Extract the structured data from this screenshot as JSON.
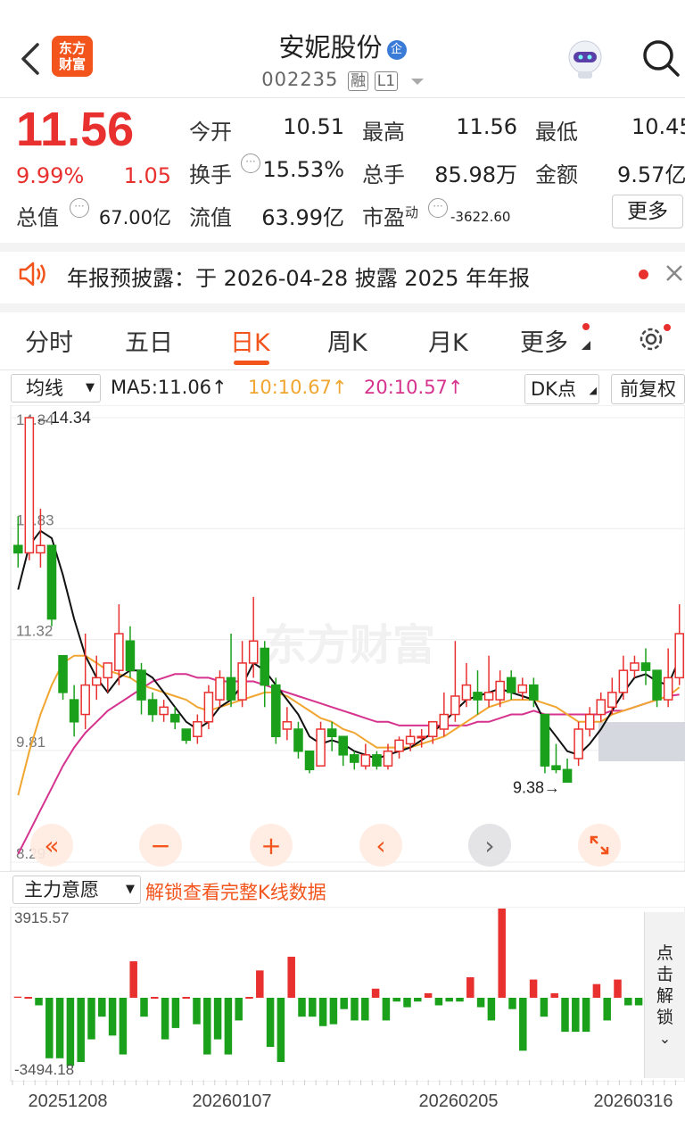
{
  "header": {
    "logo_line1": "东方",
    "logo_line2": "财富",
    "stock_name": "安妮股份",
    "badge": "企",
    "stock_code": "002235",
    "tag_rong": "融",
    "tag_level": "L1"
  },
  "quote": {
    "price": "11.56",
    "change_pct": "9.99%",
    "change_amt": "1.05",
    "fields": [
      {
        "label": "今开",
        "value": "10.51",
        "color": "#222222"
      },
      {
        "label": "最高",
        "value": "11.56",
        "color": "#e8312f"
      },
      {
        "label": "最低",
        "value": "10.45",
        "color": "#1aa01a"
      },
      {
        "label": "换手",
        "value": "15.53%",
        "color": "#222222"
      },
      {
        "label": "总手",
        "value": "85.98万",
        "color": "#222222"
      },
      {
        "label": "金额",
        "value": "9.57亿",
        "color": "#222222"
      },
      {
        "label": "总值",
        "value": "67.00亿",
        "color": "#222222"
      },
      {
        "label": "流值",
        "value": "63.99亿",
        "color": "#222222"
      },
      {
        "label": "市盈",
        "sup": "动",
        "value": "-3622.60",
        "color": "#222222"
      }
    ],
    "more_button": "更多"
  },
  "notice": {
    "text": "年报预披露：于 2026-04-28 披露 2025 年年报"
  },
  "tabs": [
    "分时",
    "五日",
    "日K",
    "周K",
    "月K",
    "更多"
  ],
  "active_tab": "日K",
  "indicator_bar": {
    "select": "均线",
    "ma5": "MA5:11.06",
    "ma10": "10:10.67",
    "ma20": "20:10.57",
    "dk_button": "DK点",
    "adjust_button": "前复权"
  },
  "chart_data": {
    "type": "candlestick",
    "y_ticks": [
      "14.34",
      "12.83",
      "11.32",
      "9.81",
      "8.29"
    ],
    "ylim": [
      8.29,
      14.34
    ],
    "max_label": "14.34",
    "min_label": "9.38",
    "watermark": "东方财富",
    "x_ticks": [
      "20251208",
      "20260107",
      "20260205",
      "20260316"
    ],
    "candles": [
      [
        12.6,
        12.5,
        13.0,
        12.3
      ],
      [
        12.5,
        14.34,
        14.34,
        12.4
      ],
      [
        12.5,
        12.6,
        13.1,
        12.3
      ],
      [
        12.6,
        11.6,
        12.6,
        11.5
      ],
      [
        11.1,
        10.6,
        11.1,
        10.5
      ],
      [
        10.5,
        10.2,
        10.7,
        10.0
      ],
      [
        10.3,
        10.7,
        11.4,
        10.1
      ],
      [
        10.7,
        10.8,
        11.1,
        10.5
      ],
      [
        10.8,
        11.0,
        11.0,
        10.6
      ],
      [
        10.9,
        11.4,
        11.8,
        10.7
      ],
      [
        11.3,
        10.9,
        11.5,
        10.8
      ],
      [
        10.9,
        10.5,
        11.0,
        10.3
      ],
      [
        10.5,
        10.3,
        10.6,
        10.2
      ],
      [
        10.3,
        10.4,
        10.5,
        10.2
      ],
      [
        10.3,
        10.2,
        10.4,
        10.1
      ],
      [
        10.1,
        9.95,
        10.1,
        9.9
      ],
      [
        10.0,
        10.2,
        10.3,
        9.9
      ],
      [
        10.2,
        10.6,
        10.7,
        10.1
      ],
      [
        10.5,
        10.8,
        10.9,
        10.4
      ],
      [
        10.8,
        10.5,
        11.4,
        10.4
      ],
      [
        10.5,
        11.0,
        11.3,
        10.4
      ],
      [
        11.0,
        11.3,
        11.9,
        10.8
      ],
      [
        11.2,
        10.7,
        11.3,
        10.4
      ],
      [
        10.7,
        10.0,
        10.8,
        9.9
      ],
      [
        10.1,
        10.2,
        10.4,
        9.95
      ],
      [
        10.1,
        9.8,
        10.2,
        9.7
      ],
      [
        9.8,
        9.55,
        9.8,
        9.5
      ],
      [
        9.6,
        10.1,
        10.2,
        9.6
      ],
      [
        10.1,
        10.0,
        10.2,
        9.8
      ],
      [
        10.0,
        9.75,
        10.0,
        9.6
      ],
      [
        9.75,
        9.65,
        9.8,
        9.55
      ],
      [
        9.6,
        9.75,
        9.9,
        9.55
      ],
      [
        9.75,
        9.6,
        9.8,
        9.55
      ],
      [
        9.6,
        9.8,
        9.9,
        9.55
      ],
      [
        9.8,
        9.95,
        10.0,
        9.7
      ],
      [
        9.9,
        10.0,
        10.1,
        9.8
      ],
      [
        10.0,
        10.0,
        10.1,
        9.85
      ],
      [
        10.0,
        10.2,
        10.2,
        9.9
      ],
      [
        10.1,
        10.3,
        10.6,
        10.0
      ],
      [
        10.3,
        10.55,
        11.3,
        10.2
      ],
      [
        10.5,
        10.7,
        11.0,
        10.4
      ],
      [
        10.6,
        10.5,
        10.9,
        10.3
      ],
      [
        10.5,
        10.6,
        11.1,
        10.4
      ],
      [
        10.5,
        10.75,
        10.9,
        10.4
      ],
      [
        10.8,
        10.6,
        10.9,
        10.5
      ],
      [
        10.6,
        10.7,
        10.8,
        10.5
      ],
      [
        10.7,
        10.5,
        10.8,
        10.4
      ],
      [
        10.3,
        9.6,
        10.3,
        9.5
      ],
      [
        9.6,
        9.55,
        9.9,
        9.5
      ],
      [
        9.55,
        9.38,
        9.7,
        9.38
      ],
      [
        9.7,
        10.1,
        10.2,
        9.6
      ],
      [
        10.1,
        10.3,
        10.4,
        10.0
      ],
      [
        10.3,
        10.5,
        10.6,
        10.2
      ],
      [
        10.4,
        10.6,
        10.8,
        10.3
      ],
      [
        10.6,
        10.9,
        11.1,
        10.5
      ],
      [
        10.9,
        11.0,
        11.1,
        10.8
      ],
      [
        11.0,
        10.9,
        11.2,
        10.7
      ],
      [
        10.9,
        10.5,
        10.9,
        10.4
      ],
      [
        10.5,
        10.8,
        11.2,
        10.4
      ],
      [
        10.8,
        11.4,
        11.8,
        10.7
      ]
    ],
    "ma5": [
      12.0,
      12.6,
      12.8,
      12.7,
      12.2,
      11.6,
      11.1,
      10.8,
      10.6,
      10.8,
      10.9,
      10.9,
      10.8,
      10.6,
      10.4,
      10.2,
      10.1,
      10.2,
      10.4,
      10.5,
      10.7,
      11.0,
      10.9,
      10.7,
      10.5,
      10.3,
      10.0,
      9.9,
      9.95,
      9.9,
      9.8,
      9.75,
      9.7,
      9.75,
      9.8,
      9.85,
      9.95,
      10.05,
      10.2,
      10.35,
      10.5,
      10.55,
      10.6,
      10.65,
      10.6,
      10.55,
      10.5,
      10.2,
      10.0,
      9.8,
      9.75,
      9.9,
      10.1,
      10.35,
      10.6,
      10.8,
      10.85,
      10.75,
      10.7,
      11.06
    ],
    "ma10": [
      9.2,
      9.8,
      10.3,
      10.7,
      11.0,
      11.1,
      11.1,
      11.0,
      10.9,
      10.85,
      10.8,
      10.7,
      10.65,
      10.6,
      10.55,
      10.5,
      10.4,
      10.35,
      10.4,
      10.45,
      10.5,
      10.55,
      10.6,
      10.6,
      10.55,
      10.45,
      10.35,
      10.25,
      10.2,
      10.1,
      10.05,
      9.95,
      9.85,
      9.85,
      9.85,
      9.85,
      9.9,
      9.95,
      10.0,
      10.1,
      10.2,
      10.3,
      10.4,
      10.45,
      10.5,
      10.5,
      10.5,
      10.45,
      10.4,
      10.3,
      10.2,
      10.2,
      10.2,
      10.3,
      10.35,
      10.4,
      10.45,
      10.5,
      10.55,
      10.67
    ],
    "ma20": [
      8.4,
      8.7,
      9.0,
      9.3,
      9.6,
      9.85,
      10.05,
      10.2,
      10.35,
      10.45,
      10.55,
      10.65,
      10.75,
      10.8,
      10.85,
      10.85,
      10.8,
      10.8,
      10.75,
      10.75,
      10.75,
      10.75,
      10.7,
      10.65,
      10.6,
      10.55,
      10.5,
      10.45,
      10.4,
      10.35,
      10.3,
      10.25,
      10.2,
      10.2,
      10.15,
      10.15,
      10.15,
      10.15,
      10.15,
      10.15,
      10.15,
      10.2,
      10.2,
      10.25,
      10.3,
      10.3,
      10.35,
      10.3,
      10.3,
      10.3,
      10.3,
      10.3,
      10.3,
      10.35,
      10.35,
      10.4,
      10.45,
      10.5,
      10.55,
      10.57
    ]
  },
  "sub_indicator": {
    "select": "主力意愿",
    "unlock_text": "解锁查看完整K线数据",
    "y_top": "3915.57",
    "y_bottom": "-3494.18",
    "side_button": "点击解锁",
    "bars": [
      50,
      0,
      -400,
      -3200,
      -3200,
      -3600,
      -3400,
      -2200,
      -1000,
      -2000,
      -3000,
      1600,
      -1000,
      0,
      -2200,
      -1600,
      0,
      -1400,
      -3000,
      -2200,
      -3000,
      -1200,
      0,
      1200,
      -2600,
      -3400,
      1800,
      -1000,
      -1000,
      -1500,
      -1400,
      -600,
      -1200,
      -1200,
      400,
      -1200,
      -200,
      -500,
      -200,
      200,
      -400,
      -200,
      -200,
      900,
      -500,
      -1200,
      3915,
      -600,
      -2800,
      800,
      -1000,
      200,
      -1800,
      -1800,
      -1800,
      600,
      -1200,
      800,
      -400,
      -400
    ]
  }
}
